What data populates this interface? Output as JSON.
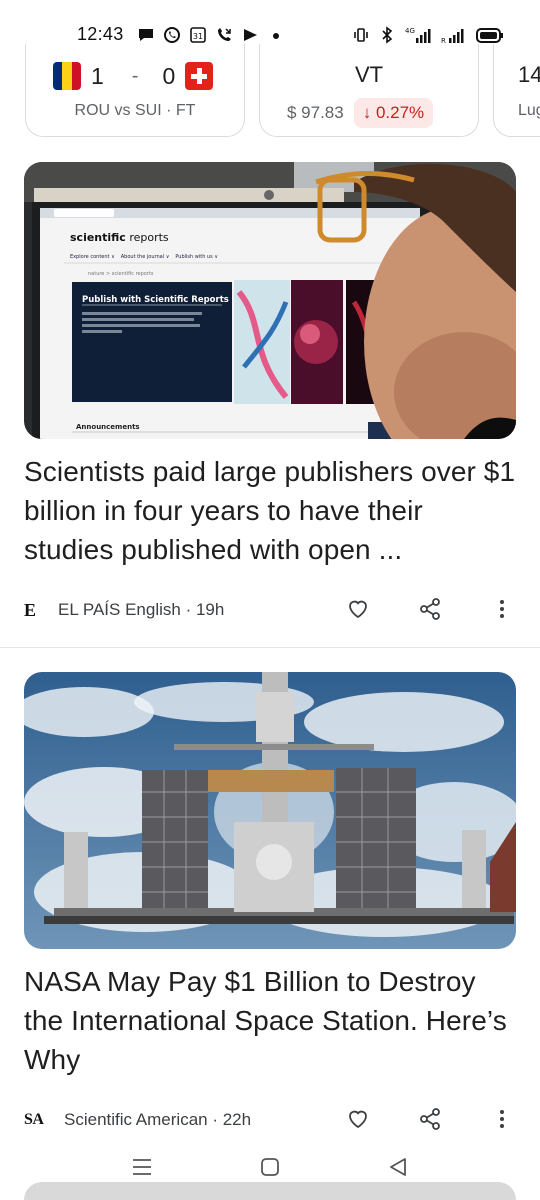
{
  "status_bar": {
    "time": "12:43",
    "left_icons": [
      "chat-bubble-icon",
      "whatsapp-icon",
      "calendar-31-icon",
      "missed-call-icon",
      "play-icon",
      "dot-icon"
    ],
    "right_icons": [
      "vibrate-icon",
      "bluetooth-icon",
      "signal-4g-icon",
      "signal-icon",
      "battery-icon"
    ],
    "network_label": "4G",
    "roaming_label": "R"
  },
  "score_card": {
    "home_score": "1",
    "separator": "-",
    "away_score": "0",
    "subtitle": "ROU vs SUI · FT",
    "colors": {
      "romania": [
        "#002b7f",
        "#fcd116",
        "#ce1126"
      ],
      "switzerland": "#e2231a"
    }
  },
  "stock_card": {
    "ticker": "VT",
    "price": "$ 97.83",
    "change": "↓ 0.27%",
    "change_color": "#c5221f"
  },
  "third_card": {
    "title": "14",
    "subtitle": "Lug"
  },
  "articles": [
    {
      "headline": "Scientists paid large publishers over $1 billion in four years to have their studies published with open ...",
      "source_logo": "E",
      "source": "EL PAÍS English · 19h",
      "image_texts": {
        "site_name_bold": "scientific",
        "site_name_light": " reports",
        "nav": [
          "Explore content ∨",
          "About the journal ∨",
          "Publish with us ∨"
        ],
        "breadcrumb": "nature > scientific reports",
        "banner_title": "Publish with Scientific Reports",
        "banner_body": "We're an open-access journal publishing rigorously peer-reviewed research from across the natural sciences, psychology, medicine and engineering.",
        "section": "Announcements"
      }
    },
    {
      "headline": "NASA May Pay $1 Billion to Destroy the International Space Station. Here’s Why",
      "source_logo": "SA",
      "source": "Scientific American · 22h"
    }
  ],
  "actions": {
    "like": "heart-icon",
    "share": "share-icon",
    "more": "more-vert-icon"
  },
  "nav": [
    "menu-icon",
    "home-icon",
    "back-icon"
  ]
}
